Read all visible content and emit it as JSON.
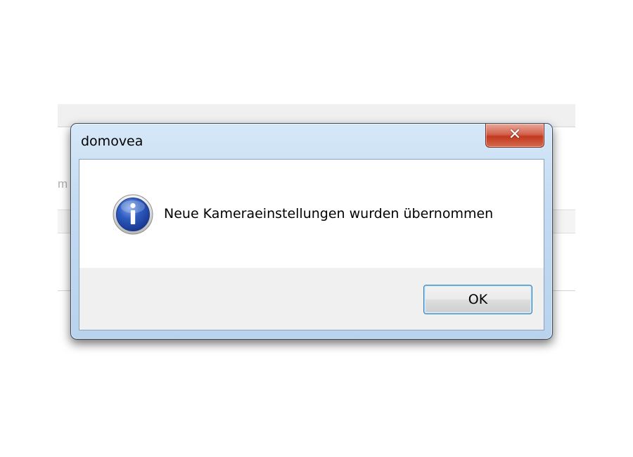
{
  "dialog": {
    "title": "domovea",
    "close_glyph": "✕",
    "icon": "info-icon",
    "message": "Neue Kameraeinstellungen wurden übernommen",
    "ok_label": "OK"
  },
  "background_app": {
    "partial_text": "m"
  },
  "colors": {
    "title_gradient_top": "#d6e8f8",
    "close_button_red": "#c2391f",
    "info_icon_blue": "#2e5bbf",
    "ok_button_border": "#3c7fb1",
    "button_area_bg": "#f0f0f0"
  }
}
